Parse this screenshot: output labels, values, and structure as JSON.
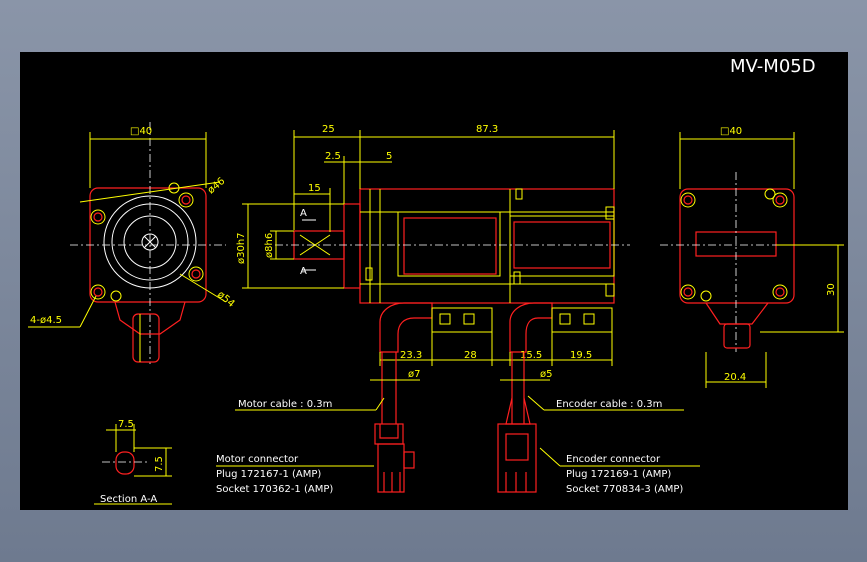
{
  "title": "MV-M05D",
  "front": {
    "square": "□40",
    "pcd": "ø46",
    "hole_note": "4-ø4.5",
    "shaft_pcd": "ø54"
  },
  "side": {
    "dims_top": [
      "25",
      "87.3"
    ],
    "dims_small": [
      "2.5",
      "5",
      "15"
    ],
    "section_mark": "A",
    "dia_flange": "ø30h7",
    "dia_shaft": "ø8h6",
    "dims_bottom": [
      "23.3",
      "28",
      "15.5",
      "19.5"
    ],
    "cable_dia_motor": "ø7",
    "cable_dia_encoder": "ø5"
  },
  "rear": {
    "square": "□40",
    "height": "30",
    "offset": "20.4"
  },
  "section": {
    "title": "Section A-A",
    "w": "7.5",
    "h": "7.5"
  },
  "motor_cable": "Motor cable : 0.3m",
  "encoder_cable": "Encoder cable : 0.3m",
  "motor_connector": {
    "title": "Motor connector",
    "plug": "Plug 172167-1 (AMP)",
    "socket": "Socket 170362-1 (AMP)"
  },
  "encoder_connector": {
    "title": "Encoder connector",
    "plug": "Plug 172169-1 (AMP)",
    "socket": "Socket 770834-3 (AMP)"
  }
}
